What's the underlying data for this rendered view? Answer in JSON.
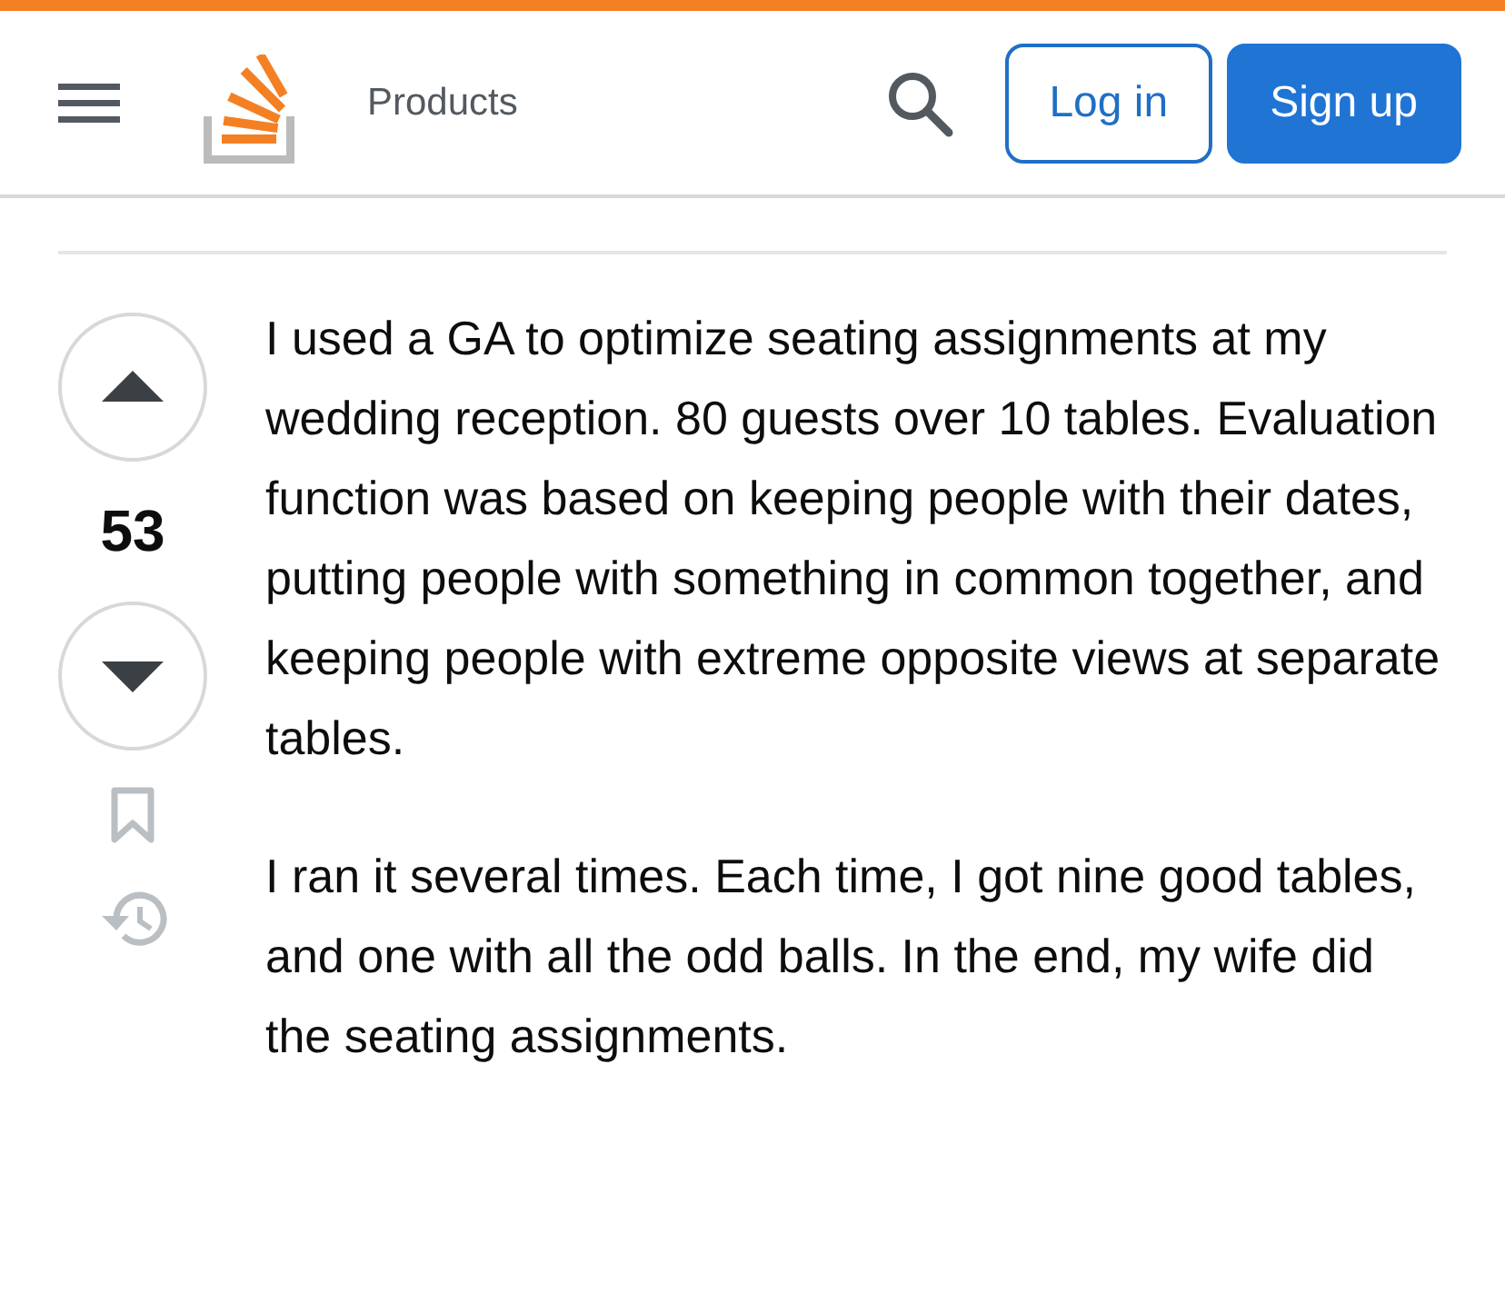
{
  "header": {
    "nav_label": "Products",
    "buttons": [
      {
        "label": "Log in",
        "kind": "outline"
      },
      {
        "label": "Sign up",
        "kind": "primary"
      }
    ]
  },
  "answer": {
    "score": "53",
    "paragraphs": [
      "I used a GA to optimize seating assignments at my wedding reception. 80 guests over 10 tables. Evaluation function was based on keeping people with their dates, putting people with something in common together, and keeping people with extreme opposite views at separate tables.",
      "I ran it several times. Each time, I got nine good tables, and one with all the odd balls. In the end, my wife did the seating assignments."
    ]
  }
}
